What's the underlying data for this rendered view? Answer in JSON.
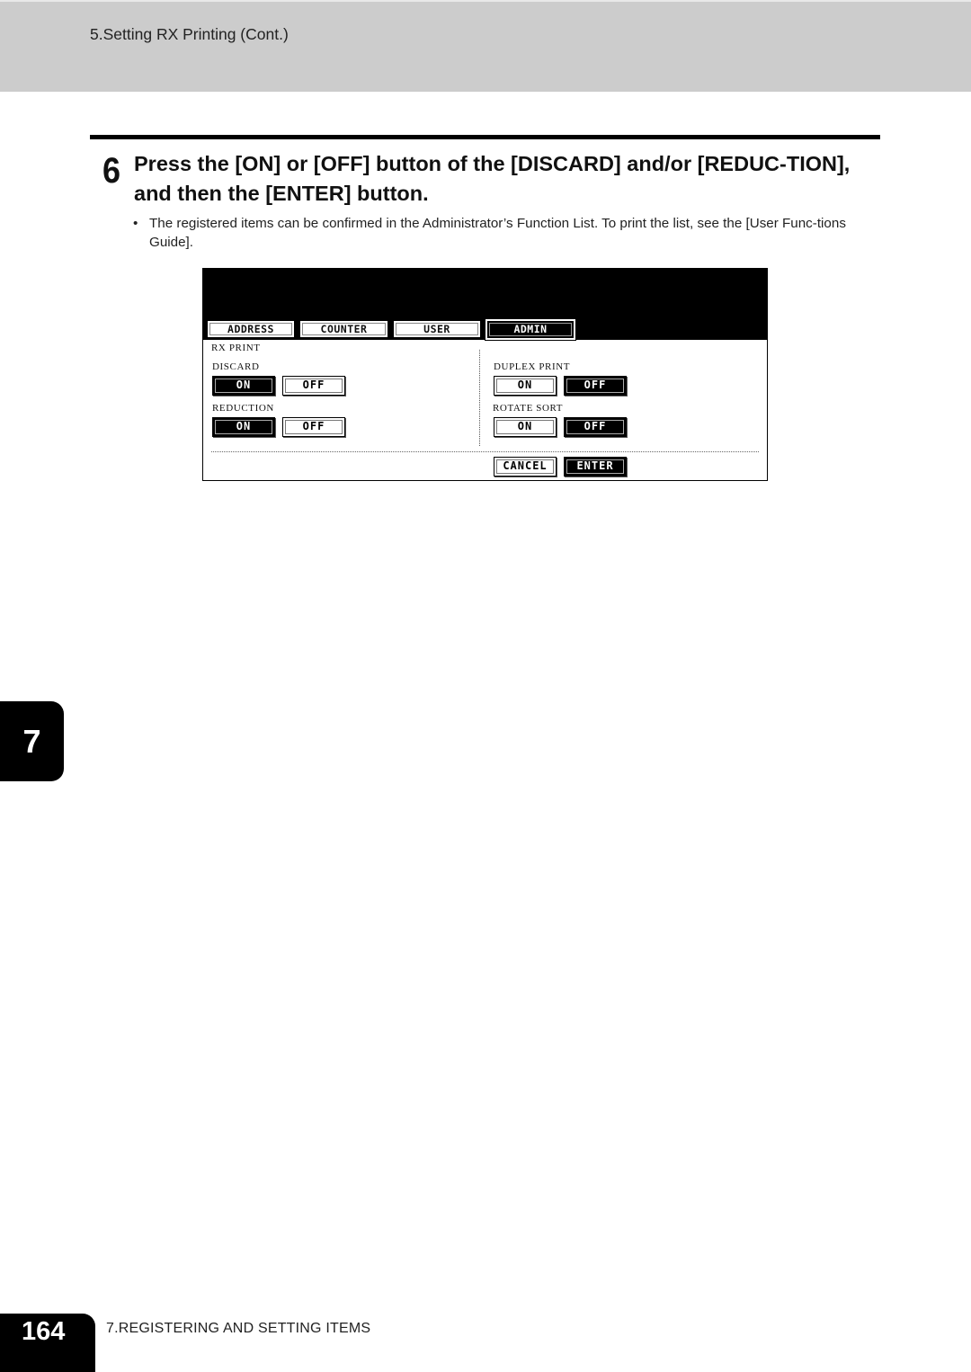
{
  "header": {
    "section_title": "5.Setting RX Printing (Cont.)"
  },
  "step": {
    "number": "6",
    "title": "Press the [ON] or [OFF] button of the [DISCARD] and/or [REDUC-TION], and then the [ENTER] button.",
    "bullet_marker": "•",
    "bullet_text": "The registered items can be confirmed in the Administrator’s Function List. To print the list, see the [User Func-tions Guide]."
  },
  "screen": {
    "tabs": [
      {
        "label": "ADDRESS",
        "active": false
      },
      {
        "label": "COUNTER",
        "active": false
      },
      {
        "label": "USER",
        "active": false
      },
      {
        "label": "ADMIN",
        "active": true
      }
    ],
    "section_label": "RX PRINT",
    "settings": [
      {
        "label": "DISCARD",
        "on_label": "ON",
        "off_label": "OFF",
        "selected": "ON"
      },
      {
        "label": "REDUCTION",
        "on_label": "ON",
        "off_label": "OFF",
        "selected": "ON"
      },
      {
        "label": "DUPLEX PRINT",
        "on_label": "ON",
        "off_label": "OFF",
        "selected": "OFF"
      },
      {
        "label": "ROTATE SORT",
        "on_label": "ON",
        "off_label": "OFF",
        "selected": "OFF"
      }
    ],
    "cancel_label": "CANCEL",
    "enter_label": "ENTER"
  },
  "chapter_tab": "7",
  "footer": {
    "page_number": "164",
    "chapter_title": "7.REGISTERING AND SETTING ITEMS"
  }
}
